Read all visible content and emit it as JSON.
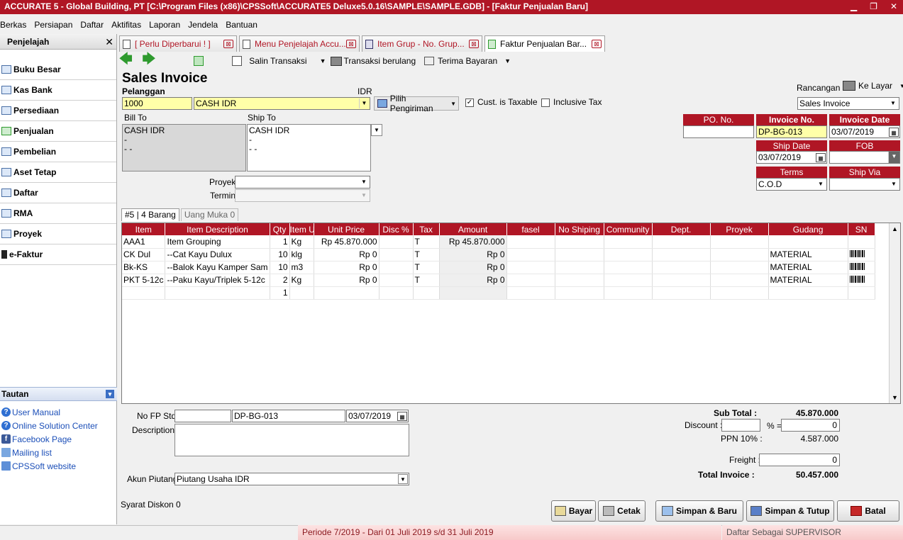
{
  "window": {
    "title": "ACCURATE 5  - Global Building, PT   [C:\\Program Files (x86)\\CPSSoft\\ACCURATE5 Deluxe5.0.16\\SAMPLE\\SAMPLE.GDB] - [Faktur Penjualan Baru]",
    "minimize": "▁",
    "restore": "❐",
    "close": "✕"
  },
  "menu": [
    "Berkas",
    "Persiapan",
    "Daftar",
    "Aktifitas",
    "Laporan",
    "Jendela",
    "Bantuan"
  ],
  "sidebar": {
    "title": "Penjelajah",
    "close": "✕",
    "items": [
      "Buku Besar",
      "Kas Bank",
      "Persediaan",
      "Penjualan",
      "Pembelian",
      "Aset Tetap",
      "Daftar",
      "RMA",
      "Proyek",
      "e-Faktur"
    ]
  },
  "tautan": {
    "title": "Tautan",
    "links": [
      "User Manual",
      "Online Solution Center",
      "Facebook Page",
      "Mailing list",
      "CPSSoft website"
    ]
  },
  "tabs": [
    {
      "label": "[ Perlu Diperbarui ! ]",
      "close": "⊠"
    },
    {
      "label": "Menu Penjelajah Accu...",
      "close": "⊠"
    },
    {
      "label": "Item Grup - No. Grup...",
      "close": "⊠"
    },
    {
      "label": "Faktur Penjualan Bar...",
      "close": "⊠"
    }
  ],
  "toolbar": {
    "back": "🡄",
    "forward": "🡆",
    "salin": "Salin Transaksi",
    "berulang": "Transaksi berulang",
    "terima": "Terima Bayaran"
  },
  "form": {
    "heading": "Sales Invoice",
    "pelanggan_label": "Pelanggan",
    "currency": "IDR",
    "customer_id": "1000",
    "customer_name": "CASH IDR",
    "pilih_pengiriman": "Pilih Pengiriman",
    "cust_taxable": "Cust. is Taxable",
    "inclusive_tax": "Inclusive Tax",
    "rancangan_label": "Rancangan",
    "ke_layar": "Ke Layar",
    "rancangan_value": "Sales Invoice",
    "bill_to_label": "Bill To",
    "bill_to_lines": [
      "CASH IDR",
      "-",
      "- -"
    ],
    "ship_to_label": "Ship To",
    "ship_to_lines": [
      "CASH IDR",
      "-",
      "- -"
    ],
    "proyek_label": "Proyek",
    "termin_label": "Termin",
    "po_label": "PO. No.",
    "po_value": "",
    "invoice_no_label": "Invoice No.",
    "invoice_no": "DP-BG-013",
    "invoice_date_label": "Invoice Date",
    "invoice_date": "03/07/2019",
    "ship_date_label": "Ship Date",
    "ship_date": "03/07/2019",
    "fob_label": "FOB",
    "fob_value": "",
    "terms_label": "Terms",
    "terms_value": "C.O.D",
    "ship_via_label": "Ship Via",
    "ship_via_value": ""
  },
  "subtabs": [
    "#5 | 4 Barang",
    "Uang Muka   0"
  ],
  "grid": {
    "columns": [
      "Item",
      "Item Description",
      "Qty",
      "Item Unit",
      "Unit Price",
      "Disc %",
      "Tax",
      "Amount",
      "fasel",
      "No Shiping",
      "Community",
      "Dept.",
      "Proyek",
      "Gudang",
      "SN"
    ],
    "rows": [
      [
        "AAA1",
        "Item Grouping",
        "1",
        "Kg",
        "Rp 45.870.000",
        "",
        "T",
        "Rp 45.870.000",
        "",
        "",
        "",
        "",
        "",
        "",
        ""
      ],
      [
        "CK Dul",
        "--Cat Kayu Dulux",
        "10",
        "klg",
        "Rp 0",
        "",
        "T",
        "Rp 0",
        "",
        "",
        "",
        "",
        "",
        "MATERIAL",
        "bar"
      ],
      [
        "Bk-KS",
        "--Balok Kayu Kamper Sam",
        "10",
        "m3",
        "Rp 0",
        "",
        "T",
        "Rp 0",
        "",
        "",
        "",
        "",
        "",
        "MATERIAL",
        "bar"
      ],
      [
        "PKT 5-12c",
        "--Paku Kayu/Triplek 5-12c",
        "2",
        "Kg",
        "Rp 0",
        "",
        "T",
        "Rp 0",
        "",
        "",
        "",
        "",
        "",
        "MATERIAL",
        "bar"
      ],
      [
        "",
        "",
        "1",
        "",
        "",
        "",
        "",
        "",
        "",
        "",
        "",
        "",
        "",
        "",
        ""
      ]
    ]
  },
  "footer": {
    "nofp_label": "No FP Std",
    "nofp_value": "",
    "nofp_doc": "DP-BG-013",
    "nofp_date": "03/07/2019",
    "description_label": "Description:",
    "akun_label": "Akun Piutang",
    "akun_value": "Piutang Usaha IDR",
    "syarat": "Syarat Diskon 0",
    "subtotal_label": "Sub Total :",
    "subtotal": "45.870.000",
    "discount_label": "Discount :",
    "pct": "% =",
    "discount_value": "0",
    "ppn_label": "PPN 10% :",
    "ppn": "4.587.000",
    "freight_label": "Freight :",
    "freight": "0",
    "total_label": "Total Invoice :",
    "total": "50.457.000"
  },
  "buttons": {
    "bayar": "Bayar",
    "cetak": "Cetak",
    "simpan_baru": "Simpan & Baru",
    "simpan_tutup": "Simpan & Tutup",
    "batal": "Batal"
  },
  "status": {
    "periode": "Periode 7/2019 - Dari 01 Juli 2019 s/d 31 Juli 2019",
    "user": "Daftar Sebagai SUPERVISOR"
  }
}
